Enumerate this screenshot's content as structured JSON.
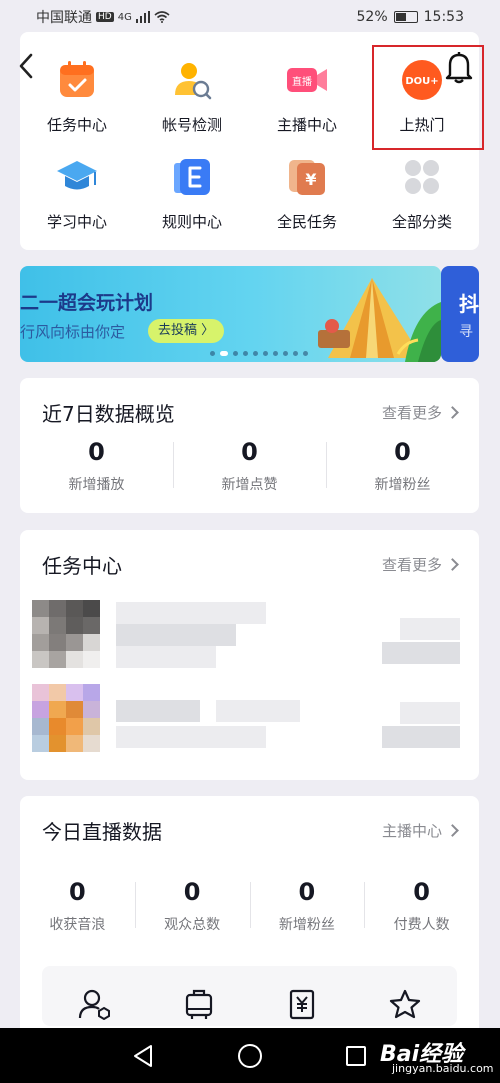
{
  "status_bar": {
    "carrier": "中国联通",
    "hd": "HD",
    "network": "4G",
    "battery": "52%",
    "battery_level": 0.52,
    "time": "15:53"
  },
  "grid": {
    "items": [
      {
        "label": "任务中心",
        "icon": "calendar-check-icon"
      },
      {
        "label": "帐号检测",
        "icon": "account-check-icon"
      },
      {
        "label": "主播中心",
        "icon": "live-camera-icon",
        "badge": "直播"
      },
      {
        "label": "上热门",
        "icon": "dou-plus-icon",
        "badge": "DOU+"
      },
      {
        "label": "学习中心",
        "icon": "graduation-cap-icon"
      },
      {
        "label": "规则中心",
        "icon": "rules-book-icon",
        "badge": "E"
      },
      {
        "label": "全民任务",
        "icon": "money-card-icon",
        "badge": "¥"
      },
      {
        "label": "全部分类",
        "icon": "all-categories-icon"
      }
    ]
  },
  "banner": {
    "title": "二一超会玩计划",
    "subtitle": "行风向标由你定",
    "button": "去投稿 〉",
    "side_title": "抖",
    "side_subtitle": "寻",
    "dot_count": 10,
    "active_dot": 1
  },
  "overview": {
    "title": "近7日数据概览",
    "more": "查看更多",
    "stats": [
      {
        "value": "0",
        "label": "新增播放"
      },
      {
        "value": "0",
        "label": "新增点赞"
      },
      {
        "value": "0",
        "label": "新增粉丝"
      }
    ]
  },
  "tasks": {
    "title": "任务中心",
    "more": "查看更多"
  },
  "live": {
    "title": "今日直播数据",
    "more": "主播中心",
    "stats": [
      {
        "value": "0",
        "label": "收获音浪"
      },
      {
        "value": "0",
        "label": "观众总数"
      },
      {
        "value": "0",
        "label": "新增粉丝"
      },
      {
        "value": "0",
        "label": "付费人数"
      }
    ],
    "tools": [
      "user-settings-icon",
      "luggage-icon",
      "money-document-icon",
      "star-icon"
    ]
  },
  "watermark": {
    "logo": "Bai经验",
    "url": "jingyan.baidu.com"
  },
  "colors": {
    "highlight": "#d7262a",
    "accent_orange": "#ff7a2a",
    "banner_blue": "#3fc0e8"
  }
}
